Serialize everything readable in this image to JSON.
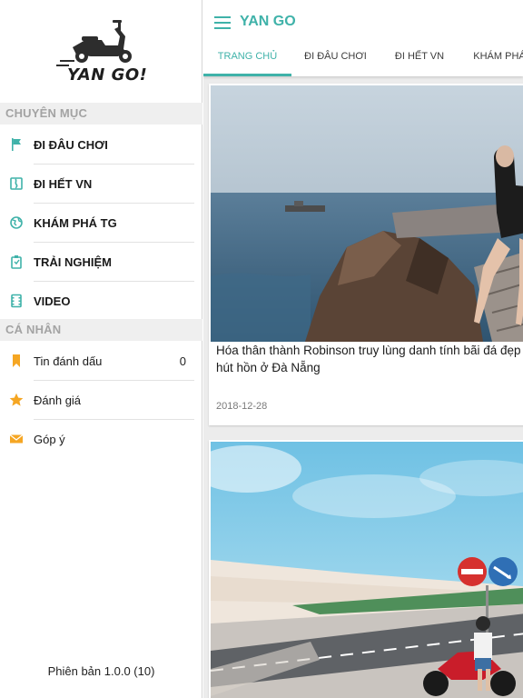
{
  "app": {
    "title": "YAN GO",
    "logo_text": "YAN GO!"
  },
  "drawer": {
    "section_categories": "CHUYÊN MỤC",
    "categories": [
      {
        "label": "ĐI ĐÂU CHƠI",
        "icon": "flag-icon"
      },
      {
        "label": "ĐI HẾT VN",
        "icon": "map-icon"
      },
      {
        "label": "KHÁM PHÁ TG",
        "icon": "globe-icon"
      },
      {
        "label": "TRẢI NGHIỆM",
        "icon": "clipboard-icon"
      },
      {
        "label": "VIDEO",
        "icon": "film-icon"
      }
    ],
    "section_personal": "CÁ NHÂN",
    "personal": [
      {
        "label": "Tin đánh dấu",
        "icon": "bookmark-icon",
        "count": "0"
      },
      {
        "label": "Đánh giá",
        "icon": "star-icon"
      },
      {
        "label": "Góp ý",
        "icon": "envelope-icon"
      }
    ],
    "version": "Phiên bản 1.0.0 (10)"
  },
  "tabs": [
    {
      "label": "TRANG CHỦ",
      "active": true
    },
    {
      "label": "ĐI ĐÂU CHƠI"
    },
    {
      "label": "ĐI HẾT VN"
    },
    {
      "label": "KHÁM PHÁ"
    }
  ],
  "articles": [
    {
      "title": "Hóa thân thành Robinson truy lùng danh tính bãi đá đẹp hút hồn ở Đà Nẵng",
      "date": "2018-12-28"
    },
    {
      "title": ""
    }
  ],
  "colors": {
    "accent": "#3fb2a9",
    "icon_accent": "#f5a623",
    "icon_teal": "#3fb2a9"
  }
}
